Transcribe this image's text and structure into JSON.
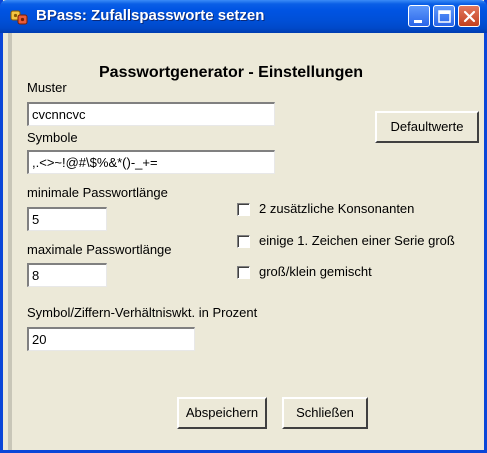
{
  "window": {
    "title": "BPass: Zufallspassworte setzen"
  },
  "heading": "Passwortgenerator - Einstellungen",
  "fields": {
    "muster": {
      "label": "Muster",
      "value": "cvcnncvc"
    },
    "symbole": {
      "label": "Symbole",
      "value": ",.<>~!@#\\$%&*()-_+="
    },
    "min_length": {
      "label": "minimale Passwortlänge",
      "value": "5"
    },
    "max_length": {
      "label": "maximale Passwortlänge",
      "value": "8"
    },
    "ratio": {
      "label": "Symbol/Ziffern-Verhältniswkt. in Prozent",
      "value": "20"
    }
  },
  "checkboxes": [
    {
      "label": "2 zusätzliche Konsonanten",
      "checked": false
    },
    {
      "label": "einige 1. Zeichen einer Serie groß",
      "checked": false
    },
    {
      "label": "groß/klein gemischt",
      "checked": false
    }
  ],
  "buttons": {
    "defaults": {
      "label": "Defaultwerte"
    },
    "save": {
      "label": "Abspeichern"
    },
    "close": {
      "label": "Schließen"
    }
  }
}
